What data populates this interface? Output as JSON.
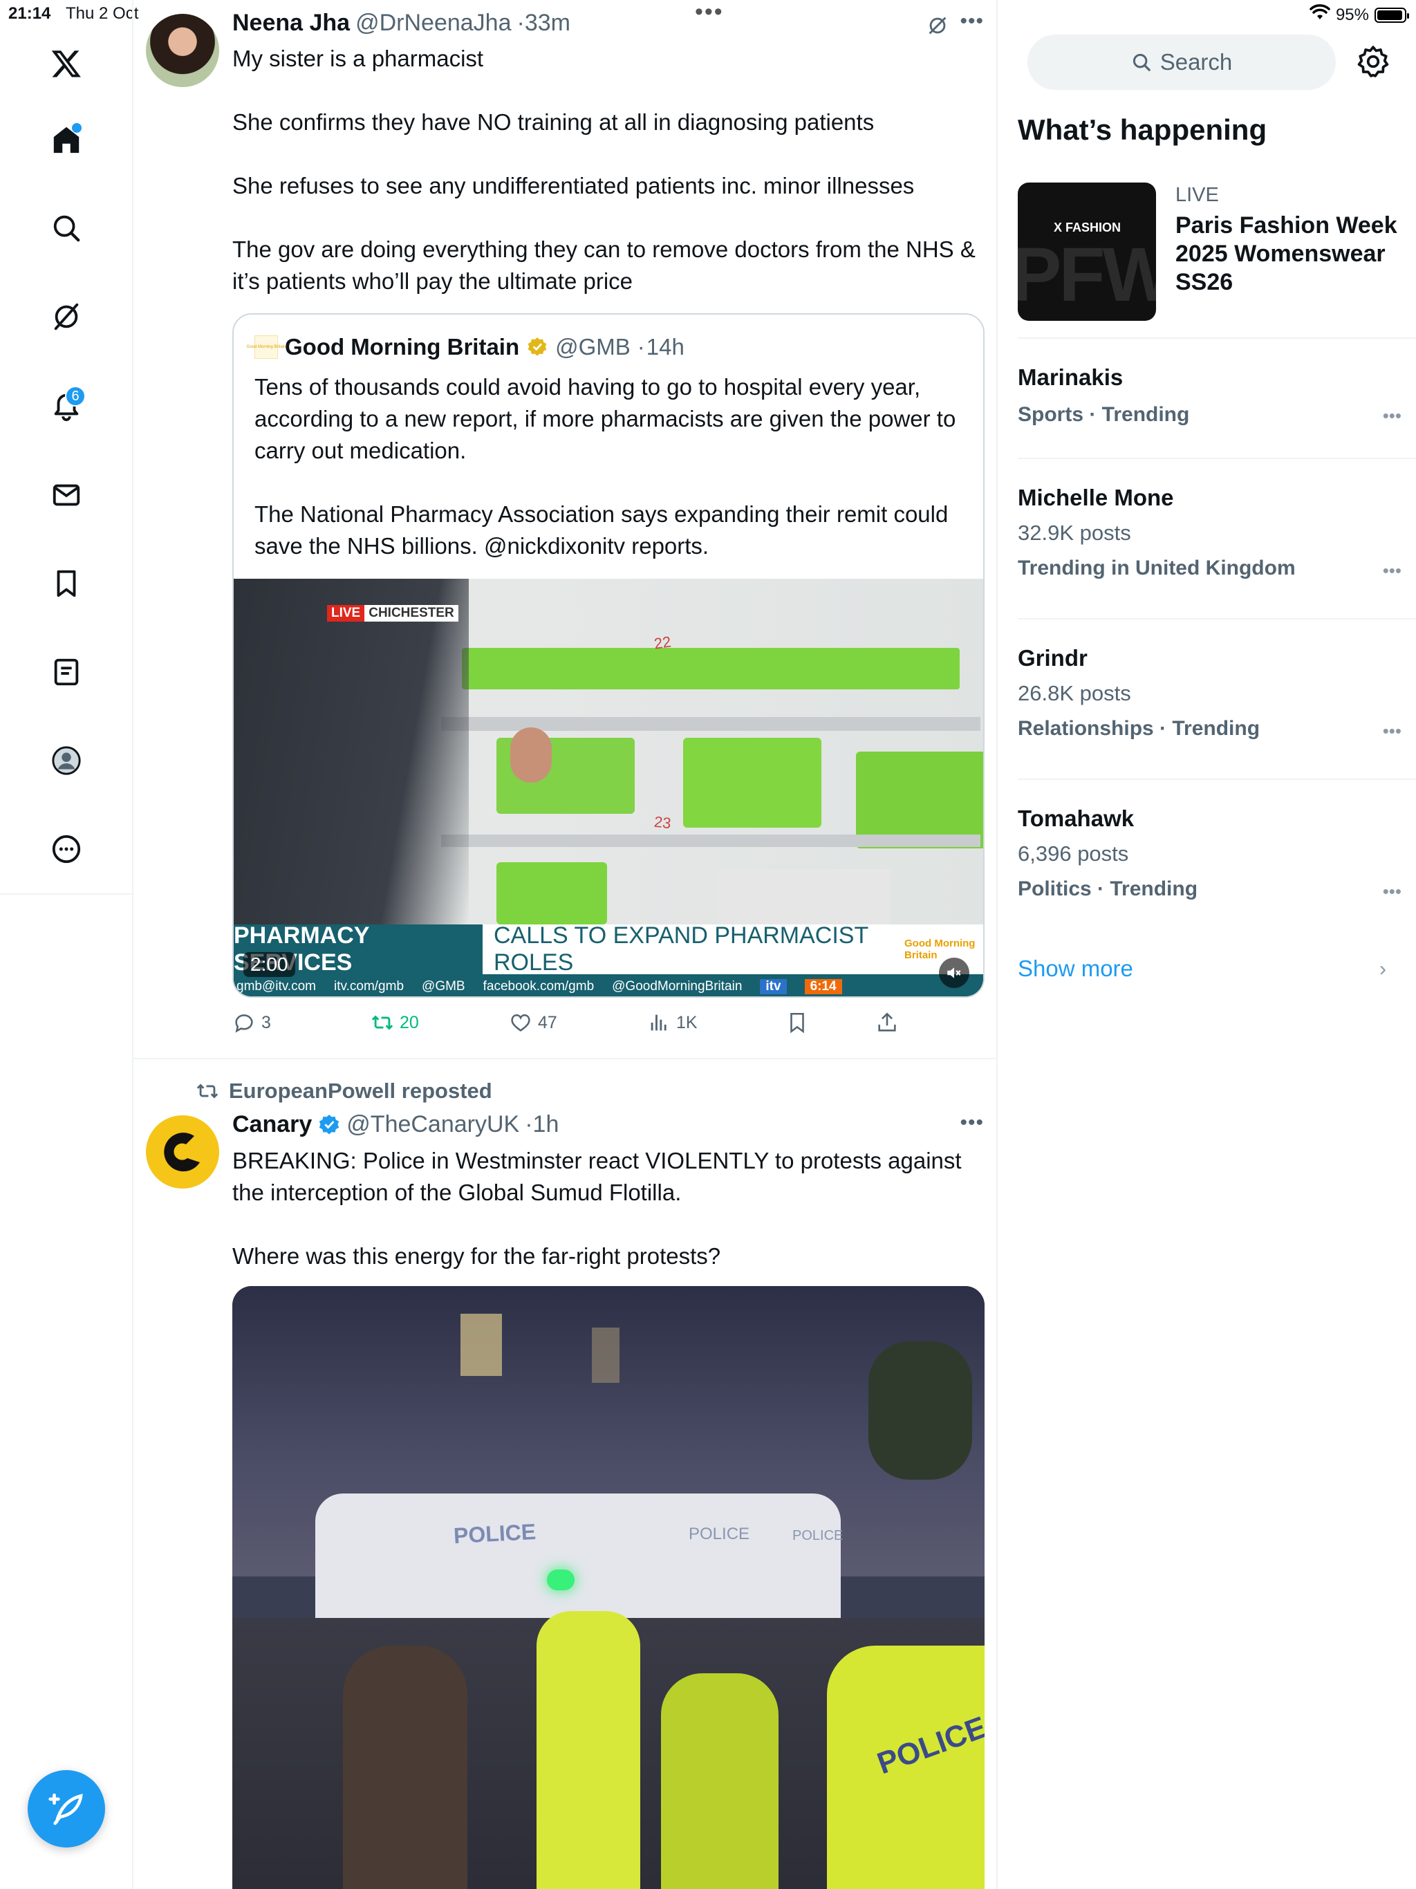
{
  "status_bar": {
    "time": "21:14",
    "date": "Thu 2 Oct",
    "battery": "95%",
    "battery_level": 0.95
  },
  "nav": {
    "notifications_badge": "6",
    "items": [
      "x-logo",
      "home",
      "explore",
      "grok",
      "notifications",
      "messages",
      "bookmarks",
      "lists",
      "profile",
      "more"
    ]
  },
  "tweet1": {
    "author_name": "Neena Jha",
    "handle": "@DrNeenaJha",
    "sep": "·",
    "time": "33m",
    "text": "My sister is a pharmacist\n\nShe confirms they have NO training at all in diagnosing patients\n\nShe refuses to see any undifferentiated patients inc. minor illnesses\n\nThe gov are doing everything they can to remove doctors from the NHS & it’s patients who’ll pay the ultimate price",
    "quote": {
      "author_name": "Good Morning Britain",
      "handle": "@GMB",
      "sep": "·",
      "time": "14h",
      "logo_text": "Good Morning Britain",
      "text": "Tens of thousands could avoid having to go to hospital every year, according to a new report, if more pharmacists are given the power to carry out medication.\n\nThe National Pharmacy Association says expanding their remit could save the NHS billions.   @nickdixonitv reports.",
      "video": {
        "live": "LIVE",
        "location": "CHICHESTER",
        "shelf_label_1": "22",
        "shelf_label_2": "23",
        "banner_left": "PHARMACY SERVICES",
        "banner_right": "CALLS TO EXPAND PHARMACIST ROLES",
        "gmb_small": "Good Morning Britain",
        "ticker_email": "gmb@itv.com",
        "ticker_site": "itv.com/gmb",
        "ticker_x": "@GMB",
        "ticker_fb": "facebook.com/gmb",
        "ticker_tiktok": "@GoodMorningBritain",
        "itv": "itv",
        "clock": "6:14",
        "duration": "2:00"
      }
    },
    "actions": {
      "replies": "3",
      "reposts": "20",
      "likes": "47",
      "views": "1K"
    }
  },
  "tweet2": {
    "reposted_by": "EuropeanPowell reposted",
    "author_name": "Canary",
    "handle": "@TheCanaryUK",
    "sep": "·",
    "time": "1h",
    "text": "BREAKING: Police in Westminster react VIOLENTLY to protests against the interception of the Global Sumud Flotilla.\n\nWhere was this energy for the far-right protests?",
    "media": {
      "van_text_1": "POLICE",
      "van_text_2": "POLICE",
      "van_text_3": "POLICE",
      "vest_text": "POLICE"
    }
  },
  "sidebar": {
    "search_placeholder": "Search",
    "whats_happening": "What’s happening",
    "event": {
      "status": "LIVE",
      "title": "Paris Fashion Week 2025 Womenswear SS26",
      "logo": "X FASHION",
      "bg_text": "PFW"
    },
    "trends": [
      {
        "name": "Marinakis",
        "category": "Sports · Trending"
      },
      {
        "name": "Michelle Mone",
        "posts": "32.9K posts",
        "category": "Trending in United Kingdom"
      },
      {
        "name": "Grindr",
        "posts": "26.8K posts",
        "category": "Relationships · Trending"
      },
      {
        "name": "Tomahawk",
        "posts": "6,396 posts",
        "category": "Politics · Trending"
      }
    ],
    "show_more": "Show more"
  },
  "colors": {
    "accent": "#1d9bf0",
    "repost_green": "#00ba7c",
    "text": "#0f1419",
    "muted": "#536471"
  }
}
